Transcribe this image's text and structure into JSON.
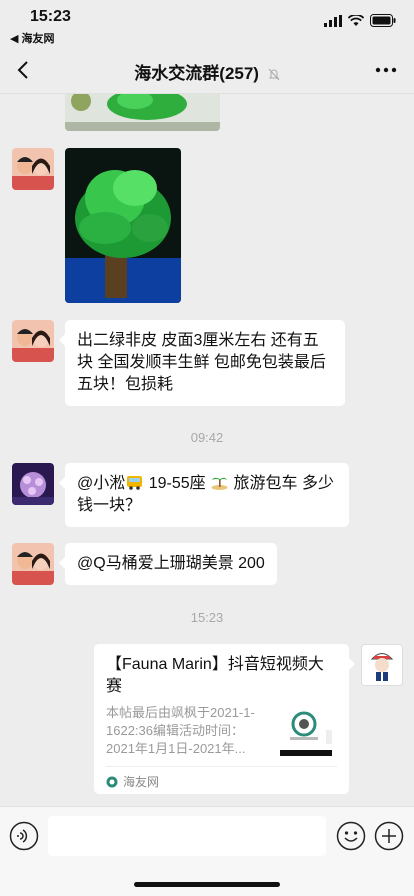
{
  "status_bar": {
    "time": "15:23",
    "back_app": "◀ 海友网"
  },
  "nav": {
    "title": "海水交流群(257)"
  },
  "messages": {
    "m2_text": "出二绿非皮 皮面3厘米左右 还有五块 全国发顺丰生鲜 包邮免包装最后五块！包损耗",
    "time1": "09:42",
    "m3_part1": "@小淞",
    "m3_part2": "19-55座",
    "m3_part3": "旅游包车 多少钱一块？",
    "m4_text": "@Q马桶爱上珊瑚美景 200",
    "time2": "15:23"
  },
  "card": {
    "title": "【Fauna Marin】抖音短视频大赛",
    "description": "本帖最后由飒枫于2021-1-1622:36编辑活动时间：2021年1月1日-2021年...",
    "source": "海友网"
  },
  "input": {
    "value": ""
  },
  "colors": {
    "background": "#ededed",
    "bubble": "#ffffff",
    "coral_green": "#2fbf4a"
  }
}
